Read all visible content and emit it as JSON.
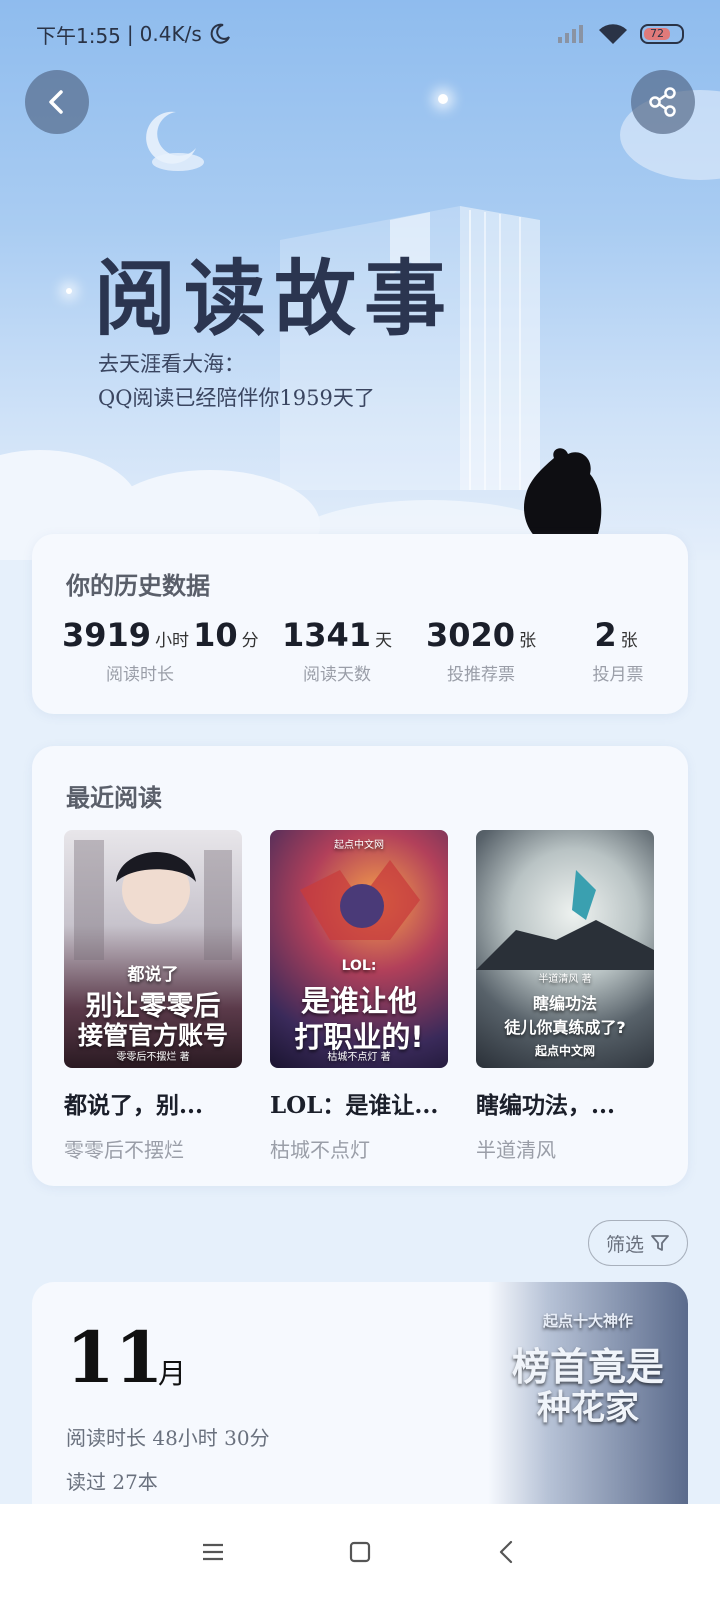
{
  "status_bar": {
    "time": "下午1:55",
    "speed": "0.4K/s",
    "battery": "72"
  },
  "hero": {
    "title": "阅读故事",
    "subtitle_line1": "去天涯看大海：",
    "subtitle_line2": "QQ阅读已经陪伴你1959天了"
  },
  "history": {
    "title": "你的历史数据",
    "stats": [
      {
        "value": "3919",
        "unit": "小时",
        "value2": "10",
        "unit2": "分",
        "label": "阅读时长"
      },
      {
        "value": "1341",
        "unit": "天",
        "label": "阅读天数"
      },
      {
        "value": "3020",
        "unit": "张",
        "label": "投推荐票"
      },
      {
        "value": "2",
        "unit": "张",
        "label": "投月票"
      }
    ]
  },
  "recent": {
    "title": "最近阅读",
    "books": [
      {
        "title": "都说了，别...",
        "author": "零零后不摆烂",
        "cover_line1": "都说了",
        "cover_line2": "别让零零后",
        "cover_line3": "接管官方账号",
        "cover_author": "零零后不摆烂 著"
      },
      {
        "title": "LOL：是谁让...",
        "author": "枯城不点灯",
        "cover_line1": "LOL:",
        "cover_line2": "是谁让他",
        "cover_line3": "打职业的!",
        "cover_author": "枯城不点灯 著",
        "cover_brand": "起点中文网"
      },
      {
        "title": "瞎编功法，...",
        "author": "半道清风",
        "cover_line1": "半道清风 著",
        "cover_line2": "瞎编功法",
        "cover_line3": "徒儿你真练成了?",
        "cover_author": "起点中文网"
      }
    ]
  },
  "filter": {
    "label": "筛选"
  },
  "month": {
    "number": "11",
    "unit": "月",
    "duration": "阅读时长 48小时 30分",
    "books_read": "读过 27本",
    "cover_text1": "起点十大神作",
    "cover_text2": "榜首竟是",
    "cover_text3": "种花家"
  },
  "colors": {
    "hero_top": "#8fbcee",
    "background": "#e6f0fb",
    "card": "#f6f9fe"
  },
  "icons": [
    "back-icon",
    "share-icon",
    "filter-icon",
    "menu-icon",
    "home-icon",
    "nav-back-icon"
  ]
}
